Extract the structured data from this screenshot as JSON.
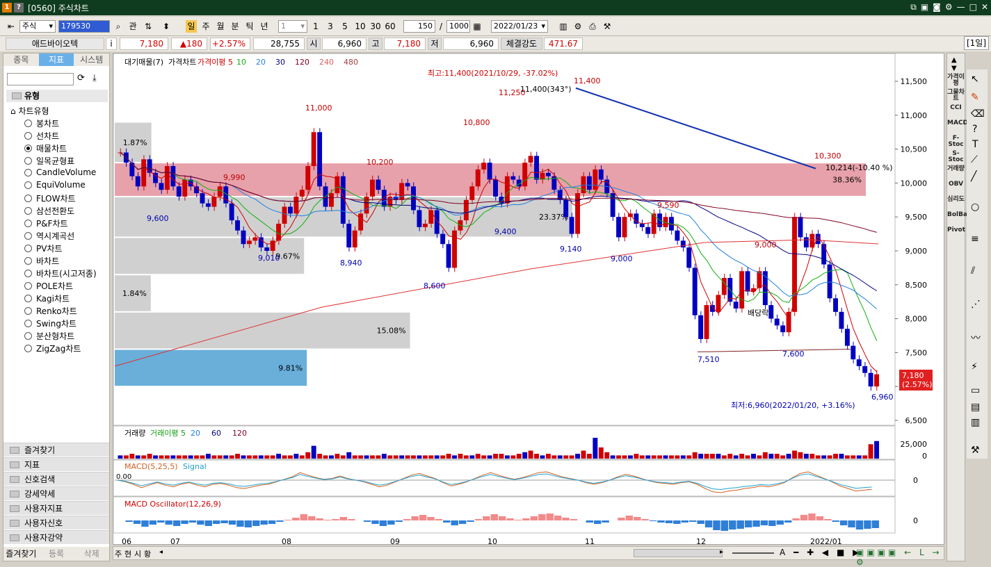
{
  "window": {
    "title": "[0560] 주식차트",
    "badge": "1",
    "help": "?"
  },
  "toolbar": {
    "market": "주식",
    "code": "179530",
    "gwan": "관",
    "periods": [
      "일",
      "주",
      "월",
      "분",
      "틱",
      "년"
    ],
    "count_sel": "1",
    "nums": [
      "1",
      "3",
      "5",
      "10",
      "30",
      "60"
    ],
    "view_count": "150",
    "slash": "/",
    "total": "1000",
    "date": "2022/01/23"
  },
  "quote": {
    "name": "애드바이오텍",
    "info": "i",
    "price": "7,180",
    "change": "▲180",
    "rate": "+2.57%",
    "volume": "28,755",
    "open_label": "시",
    "open": "6,960",
    "high_label": "고",
    "high": "7,180",
    "low_label": "저",
    "low": "6,960",
    "strength_label": "체결강도",
    "strength": "471.67",
    "period": "[1일]"
  },
  "left_panel": {
    "tabs": [
      "종목",
      "지표",
      "시스템"
    ],
    "section": "유형",
    "group": "차트유형",
    "chart_types": [
      "봉차트",
      "선차트",
      "매물차트",
      "일목균형표",
      "CandleVolume",
      "EquiVolume",
      "FLOW차트",
      "삼선전환도",
      "P&F차트",
      "역시계곡선",
      "PV차트",
      "바차트",
      "바차트(시고저종)",
      "POLE차트",
      "Kagi차트",
      "Renko차트",
      "Swing차트",
      "분산형차트",
      "ZigZag차트"
    ],
    "selected_index": 2,
    "folders": [
      "즐겨찾기",
      "지표",
      "신호검색",
      "강세약세",
      "사용자지표",
      "사용자신호",
      "사용자강약"
    ],
    "bottom_tabs": [
      "즐겨찾기",
      "등록",
      "삭제"
    ]
  },
  "right_indicators": [
    "가격이평",
    "그물차트",
    "CCI",
    "MACD",
    "F-Stoc",
    "S-Stoc",
    "거래량",
    "OBV",
    "심리도",
    "BolBand",
    "Pivot"
  ],
  "chart_data": {
    "type": "candlestick",
    "price_legend": [
      "대기매물(7)",
      "가격차트",
      "가격이평 5",
      "10",
      "20",
      "30",
      "120",
      "240",
      "480"
    ],
    "y_ticks": [
      "11,500",
      "11,000",
      "10,500",
      "10,000",
      "9,500",
      "9,000",
      "8,500",
      "8,000",
      "7,500",
      "7,000",
      "6,500"
    ],
    "x_ticks": [
      "06",
      "07",
      "08",
      "09",
      "10",
      "11",
      "12",
      "2022/01"
    ],
    "volume_legend": [
      "거래량",
      "거래이평 5",
      "20",
      "60",
      "120"
    ],
    "volume_ticks": [
      "25,000",
      "0"
    ],
    "macd_legend": [
      "MACD(5,25,5)",
      "Signal"
    ],
    "macd_zero": "0.00",
    "macd_tick": "0",
    "osc_legend": "MACD Oscillator(12,26,9)",
    "osc_tick": "0",
    "profile": [
      {
        "low": 9800,
        "high": 10300,
        "pct": "38.36%",
        "color": "#e3919b"
      },
      {
        "low": 9200,
        "high": 9800,
        "pct": "23.37%",
        "color": "#c8c8c8"
      },
      {
        "low": 8650,
        "high": 9200,
        "pct": "9.67%",
        "color": "#c8c8c8"
      },
      {
        "low": 8100,
        "high": 8650,
        "pct": "1.84%",
        "color": "#c8c8c8"
      },
      {
        "low": 7550,
        "high": 8100,
        "pct": "15.08%",
        "color": "#c8c8c8"
      },
      {
        "low": 7000,
        "high": 7550,
        "pct": "9.81%",
        "color": "#4fa1d4"
      },
      {
        "low": 10300,
        "high": 10900,
        "pct": "1.87%",
        "color": "#c8c8c8"
      }
    ],
    "annotations": {
      "high_note": "최고:11,400(2021/10/29, -37.02%)",
      "low_note": "최저:6,960(2022/01/20, +3.16%)",
      "trend_label": "11,400(343°)",
      "trend_end": "10,214(-10.40 %)",
      "dividend": "배당락",
      "current_price": "7,180",
      "current_rate": "(2.57%)",
      "point_labels": [
        {
          "t": "11,000",
          "c": "#c00000"
        },
        {
          "t": "10,800",
          "c": "#c00000"
        },
        {
          "t": "11,250",
          "c": "#c00000"
        },
        {
          "t": "11,400",
          "c": "#c00000"
        },
        {
          "t": "10,200",
          "c": "#c00000"
        },
        {
          "t": "9,990",
          "c": "#c00000"
        },
        {
          "t": "9,590",
          "c": "#c00000"
        },
        {
          "t": "9,000",
          "c": "#c00000"
        },
        {
          "t": "10,300",
          "c": "#c00000"
        },
        {
          "t": "9,600",
          "c": "#0000b0"
        },
        {
          "t": "9,010",
          "c": "#0000b0"
        },
        {
          "t": "8,940",
          "c": "#0000b0"
        },
        {
          "t": "8,600",
          "c": "#0000b0"
        },
        {
          "t": "9,400",
          "c": "#0000b0"
        },
        {
          "t": "9,140",
          "c": "#0000b0"
        },
        {
          "t": "9,000",
          "c": "#0000b0"
        },
        {
          "t": "7,510",
          "c": "#0000b0"
        },
        {
          "t": "7,600",
          "c": "#0000b0"
        },
        {
          "t": "6,960",
          "c": "#0000b0"
        }
      ]
    },
    "closes": [
      10450,
      10300,
      10100,
      9950,
      10350,
      10150,
      10000,
      9900,
      10250,
      9950,
      9800,
      10050,
      9950,
      9850,
      9700,
      9650,
      9800,
      9950,
      9700,
      9450,
      9300,
      9100,
      9150,
      9200,
      9050,
      9000,
      9150,
      9400,
      9650,
      9550,
      9800,
      9900,
      10250,
      10750,
      9950,
      9650,
      9850,
      10100,
      9400,
      9050,
      9300,
      9550,
      9800,
      10050,
      9900,
      9650,
      9800,
      9750,
      10000,
      9950,
      9600,
      9350,
      9400,
      9600,
      9250,
      9100,
      8750,
      9300,
      9450,
      9750,
      9950,
      10200,
      10300,
      10050,
      9800,
      9700,
      10100,
      10050,
      9950,
      10300,
      10400,
      10050,
      10150,
      10100,
      9900,
      9750,
      9500,
      9250,
      9850,
      10100,
      9900,
      10200,
      10050,
      9850,
      9500,
      9200,
      9500,
      9550,
      9400,
      9350,
      9250,
      9550,
      9350,
      9500,
      9300,
      9150,
      9050,
      8750,
      8050,
      7700,
      8200,
      8100,
      8350,
      8600,
      8250,
      8150,
      8700,
      8400,
      8450,
      8700,
      8200,
      8000,
      7900,
      7800,
      8100,
      9500,
      9200,
      9050,
      9250,
      9100,
      8800,
      8300,
      8100,
      7850,
      7600,
      7400,
      7300,
      7200,
      7000,
      7180
    ],
    "volumes": [
      2,
      2,
      3,
      2,
      2,
      3,
      2,
      2,
      2,
      2,
      2,
      2,
      2,
      2,
      2,
      3,
      2,
      2,
      2,
      2,
      3,
      2,
      2,
      2,
      2,
      2,
      2,
      3,
      2,
      2,
      3,
      2,
      4,
      8,
      3,
      2,
      2,
      3,
      2,
      4,
      2,
      2,
      2,
      2,
      2,
      3,
      2,
      2,
      2,
      2,
      2,
      2,
      2,
      2,
      2,
      2,
      3,
      2,
      3,
      2,
      2,
      3,
      2,
      2,
      3,
      3,
      2,
      2,
      3,
      4,
      5,
      3,
      2,
      3,
      2,
      2,
      2,
      2,
      3,
      5,
      3,
      13,
      7,
      4,
      2,
      2,
      2,
      2,
      3,
      2,
      2,
      2,
      2,
      2,
      2,
      2,
      2,
      2,
      4,
      3,
      3,
      3,
      3,
      2,
      3,
      2,
      3,
      2,
      3,
      2,
      4,
      3,
      3,
      2,
      3,
      5,
      4,
      3,
      3,
      2,
      2,
      2,
      3,
      3,
      2,
      2,
      2,
      2,
      9,
      11
    ],
    "macd": [
      0,
      -0.2,
      -0.5,
      -0.9,
      -0.6,
      -0.3,
      -0.6,
      -0.8,
      -0.5,
      -0.3,
      -0.6,
      -0.8,
      -0.5,
      -0.4,
      -0.6,
      -0.9,
      -1.0,
      -0.8,
      -0.6,
      -0.5,
      -0.2,
      0.1,
      0.4,
      0.9,
      0.6,
      0.3,
      0.1,
      0.2,
      0.5,
      0.2,
      0,
      -0.2,
      -0.5,
      -0.8,
      -0.6,
      -0.2,
      0.2,
      0.6,
      0.8,
      0.5,
      0.2,
      -0.3,
      -0.7,
      -0.5,
      -0.2,
      0.2,
      0.6,
      0.9,
      0.6,
      0.3,
      0.1,
      0.3,
      0.6,
      0.9,
      1.0,
      0.7,
      0.4,
      0.2,
      0,
      -0.3,
      -0.5,
      -0.3,
      0,
      0.4,
      0.7,
      0.5,
      0.2,
      -0.1,
      -0.3,
      -0.4,
      -0.5,
      -0.3,
      -0.2,
      -0.5,
      -1.0,
      -1.4,
      -1.5,
      -1.3,
      -1.2,
      -1.0,
      -0.9,
      -0.7,
      -0.8,
      -0.6,
      -0.3,
      0.3,
      0.8,
      1.0,
      0.6,
      0.2,
      -0.2,
      -0.7,
      -1.0,
      -1.3,
      -1.2,
      -1.1
    ]
  }
}
